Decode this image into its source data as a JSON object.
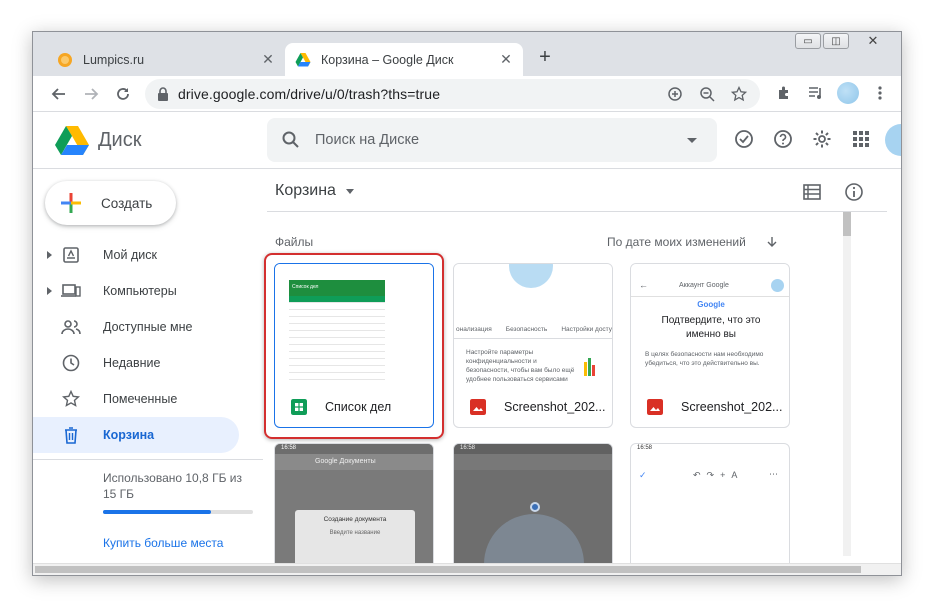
{
  "browser": {
    "tabs": [
      {
        "title": "Lumpics.ru",
        "active": false
      },
      {
        "title": "Корзина – Google Диск",
        "active": true
      }
    ],
    "new_tab": "+",
    "close": "✕",
    "url": "drive.google.com/drive/u/0/trash?ths=true",
    "window_controls": {
      "minimize": "▭",
      "restore": "◫",
      "close": "✕"
    }
  },
  "drive": {
    "logo_text": "Диск",
    "search_placeholder": "Поиск на Диске",
    "create_label": "Создать",
    "nav": [
      {
        "label": "Мой диск",
        "icon": "my-drive-icon",
        "expandable": true
      },
      {
        "label": "Компьютеры",
        "icon": "computer-icon",
        "expandable": true
      },
      {
        "label": "Доступные мне",
        "icon": "shared-icon",
        "expandable": false
      },
      {
        "label": "Недавние",
        "icon": "clock-icon",
        "expandable": false
      },
      {
        "label": "Помеченные",
        "icon": "star-icon",
        "expandable": false
      },
      {
        "label": "Корзина",
        "icon": "trash-icon",
        "expandable": false,
        "active": true
      }
    ],
    "storage": {
      "text": "Использовано 10,8 ГБ из 15 ГБ",
      "used_fraction": 0.72,
      "buy_label": "Купить больше места"
    }
  },
  "main": {
    "title": "Корзина",
    "files_label": "Файлы",
    "sort_label": "По дате моих изменений",
    "files": [
      {
        "name": "Список дел",
        "type": "sheets",
        "selected": true
      },
      {
        "name": "Screenshot_202...",
        "type": "image"
      },
      {
        "name": "Screenshot_202...",
        "type": "image"
      }
    ]
  },
  "thumbs": {
    "sheet_title": "Список дел",
    "privacy_tabs": [
      "онализация",
      "Безопасность",
      "Настройки досту"
    ],
    "privacy_text": "Настройте параметры конфиденциальности и безопасности, чтобы вам было ещё удобнее пользоваться сервисами",
    "account_title": "Аккаунт Google",
    "google_word": "Google",
    "confirm_title": "Подтвердите, что это именно вы",
    "confirm_text": "В целях безопасности нам необходимо убедиться, что это действительно вы.",
    "docs_app": "Google Документы",
    "create_doc": "Создание документа",
    "enter_name": "Введите название",
    "time": "16:58"
  },
  "colors": {
    "accent": "#1a73e8",
    "active_bg": "#e8f0fe",
    "highlight": "#d32f2f",
    "sheets_green": "#0f9d58",
    "image_red": "#d93025"
  }
}
